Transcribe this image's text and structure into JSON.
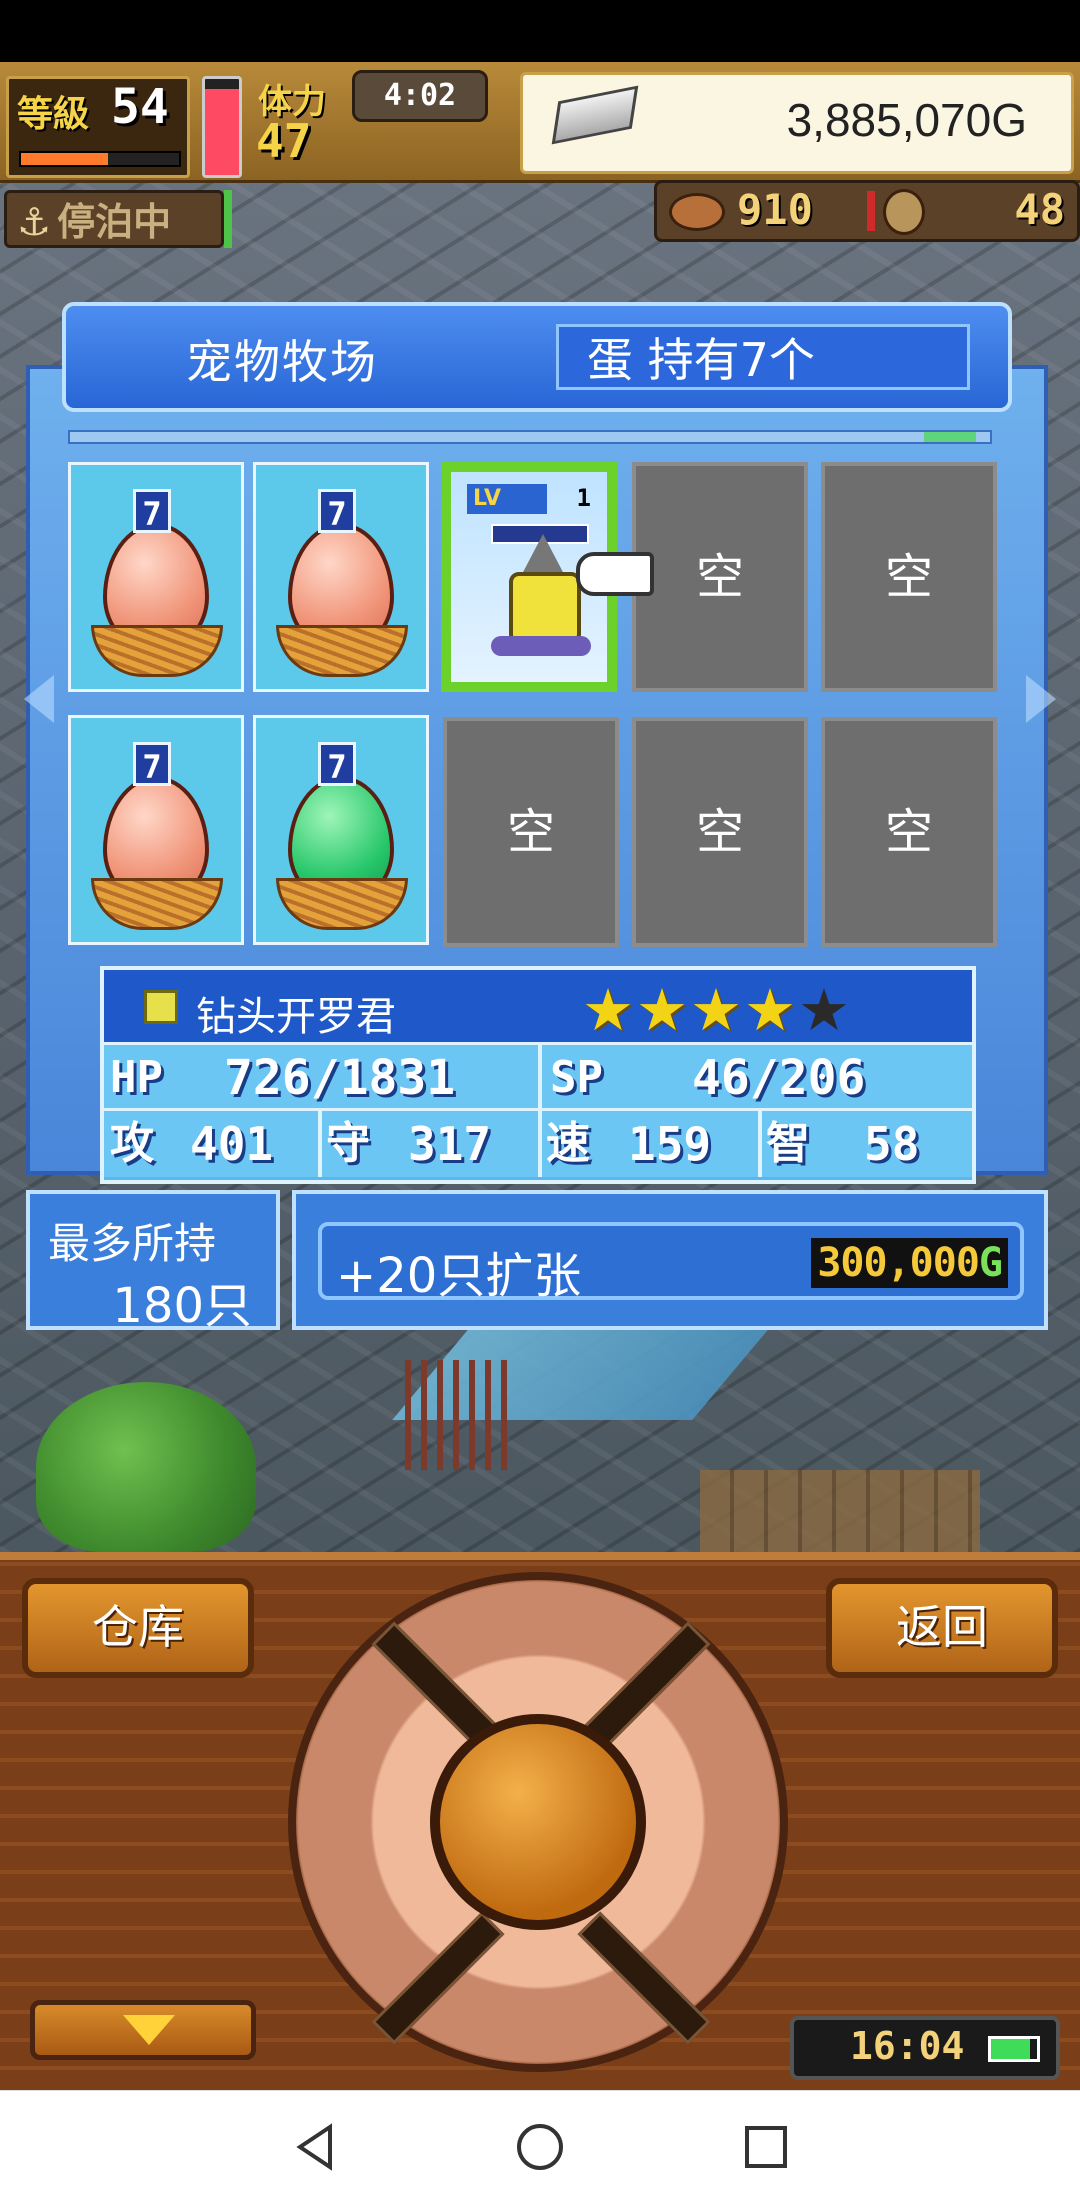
{
  "hud": {
    "level_label": "等級",
    "level": "54",
    "level_progress": 0.55,
    "stamina_label": "体力",
    "stamina": "47",
    "stamina_level": 0.9,
    "clock": "4:02",
    "money": "3,885,070G",
    "status": "停泊中",
    "res1": "910",
    "res2": "48"
  },
  "ranch": {
    "title": "宠物牧场",
    "egg_count": "蛋 持有7个",
    "egg_tag": "7",
    "empty_label": "空",
    "pet_lv_label": "LV",
    "pet_lv_num": "1"
  },
  "pet": {
    "name": "钻头开罗君",
    "stars": 4,
    "stars_max": 5,
    "stats": {
      "hp_label": "HP",
      "hp": "726/1831",
      "sp_label": "SP",
      "sp": "46/206",
      "atk_label": "攻",
      "atk": "401",
      "def_label": "守",
      "def": "317",
      "spd_label": "速",
      "spd": "159",
      "int_label": "智",
      "int": "58"
    }
  },
  "capacity": {
    "label": "最多所持",
    "value": "180只"
  },
  "expand": {
    "label": "+20只扩张",
    "price": "300,000",
    "price_unit": "G"
  },
  "buttons": {
    "warehouse": "仓库",
    "back": "返回"
  },
  "game_time": "16:04",
  "battery_level": 0.85,
  "colors": {
    "panel_blue": "#4a86d9",
    "selected_green": "#6cd12a",
    "star_gold": "#f3d316",
    "wood": "#7a3f18"
  }
}
